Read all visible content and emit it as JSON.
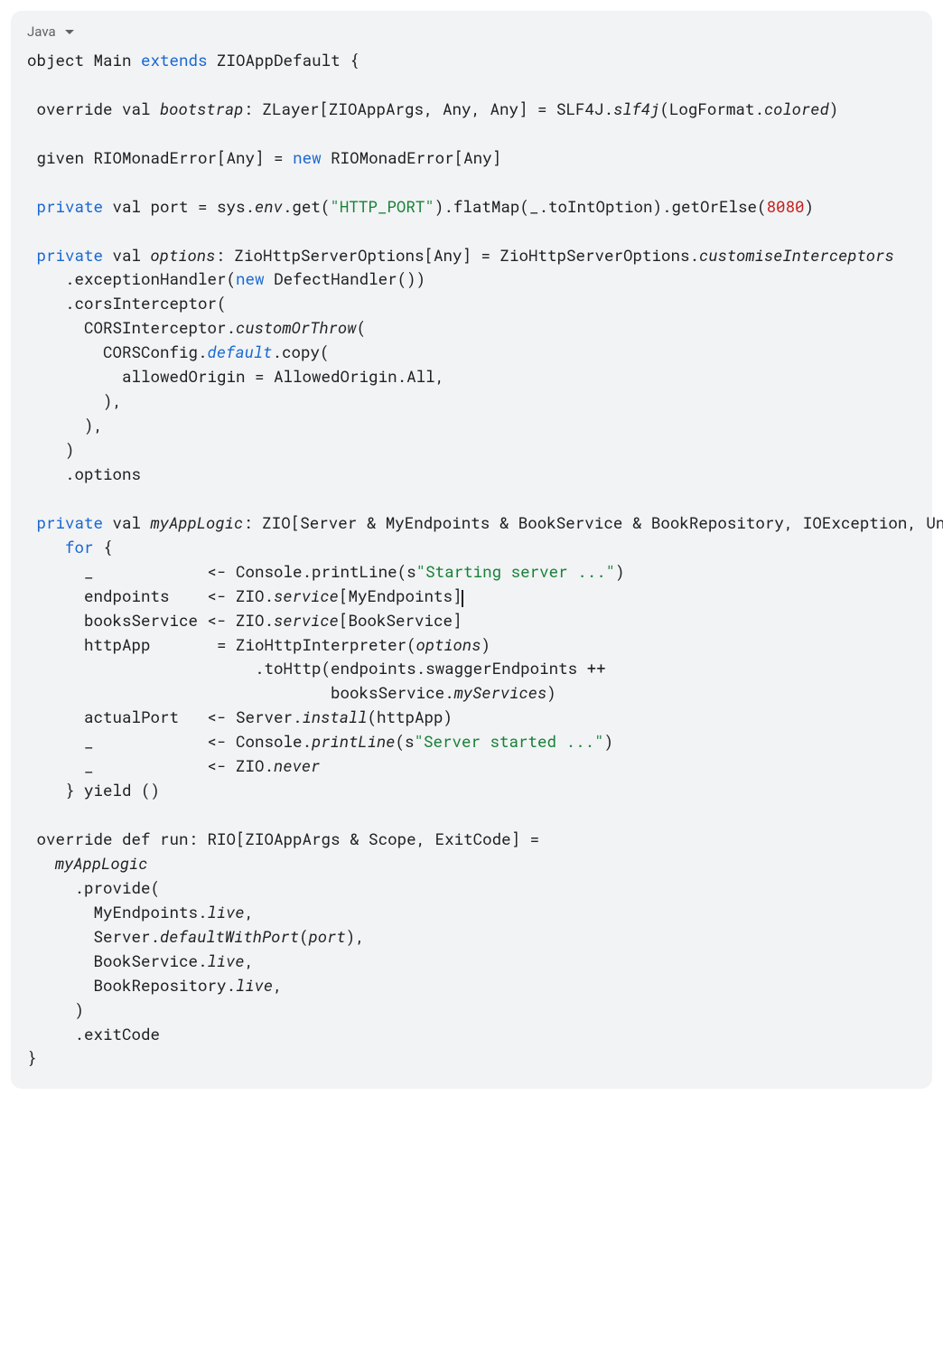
{
  "header": {
    "lang": "Java"
  },
  "code": {
    "t01": "object Main ",
    "t02": "extends",
    "t03": " ZIOAppDefault {",
    "t04": " override val ",
    "t05": "bootstrap",
    "t06": ": ZLayer[ZIOAppArgs, Any, Any] = SLF4J.",
    "t07": "slf4j",
    "t08": "(LogFormat.",
    "t09": "colored",
    "t10": ")",
    "t11": " given RIOMonadError[Any] = ",
    "t12": "new",
    "t13": " RIOMonadError[Any]",
    "t14": " private",
    "t15": " val port = sys.",
    "t16": "env",
    "t17": ".get(",
    "t18": "\"HTTP_PORT\"",
    "t19": ").flatMap(_.toIntOption).getOrElse(",
    "t20": "8080",
    "t21": ")",
    "t22": " private",
    "t23": " val ",
    "t24": "options",
    "t25": ": ZioHttpServerOptions[Any] = ZioHttpServerOptions.",
    "t26": "customiseInterceptors",
    "t27": "    .exceptionHandler(",
    "t28": "new",
    "t29": " DefectHandler())",
    "t30": "    .corsInterceptor(",
    "t31": "      CORSInterceptor.",
    "t32": "customOrThrow",
    "t33": "(",
    "t34": "        CORSConfig.",
    "t35": "default",
    "t36": ".copy(",
    "t37": "          allowedOrigin = AllowedOrigin.All,",
    "t38": "        ),",
    "t39": "      ),",
    "t40": "    )",
    "t41": "    .options",
    "t42": " private",
    "t43": " val ",
    "t44": "myAppLogic",
    "t45": ": ZIO[Server & MyEndpoints & BookService & BookRepository, IOException, Unit] =",
    "t46": "    for",
    "t47": " {",
    "t48": "      _            <- Console.printLine(s",
    "t49": "\"Starting server ...\"",
    "t50": ")",
    "t51": "      endpoints    <- ZIO.",
    "t52": "service",
    "t53": "[MyEndpoints]",
    "t54": "      booksService <- ZIO.",
    "t55": "service",
    "t56": "[BookService]",
    "t57": "      httpApp       = ZioHttpInterpreter(",
    "t58": "options",
    "t59": ")",
    "t60": "                        .toHttp(endpoints.swaggerEndpoints ++",
    "t61": "                                booksService.",
    "t62": "myServices",
    "t63": ")",
    "t64": "      actualPort   <- Server.",
    "t65": "install",
    "t66": "(httpApp)",
    "t67": "      _            <- Console.",
    "t68": "printLine",
    "t69": "(s",
    "t70": "\"Server started ...\"",
    "t71": ")",
    "t72": "      _            <- ZIO.",
    "t73": "never",
    "t74": "    } yield ()",
    "t75": " override def run: RIO[ZIOAppArgs & Scope, ExitCode] =",
    "t76": "   myAppLogic",
    "t77": "     .provide(",
    "t78": "       MyEndpoints.",
    "t79": "live",
    "t80": ",",
    "t81": "       Server.",
    "t82": "defaultWithPort",
    "t83": "(",
    "t84": "port",
    "t85": "),",
    "t86": "       BookService.",
    "t87": "live",
    "t88": ",",
    "t89": "       BookRepository.",
    "t90": "live",
    "t91": ",",
    "t92": "     )",
    "t93": "     .exitCode",
    "t94": "}"
  }
}
